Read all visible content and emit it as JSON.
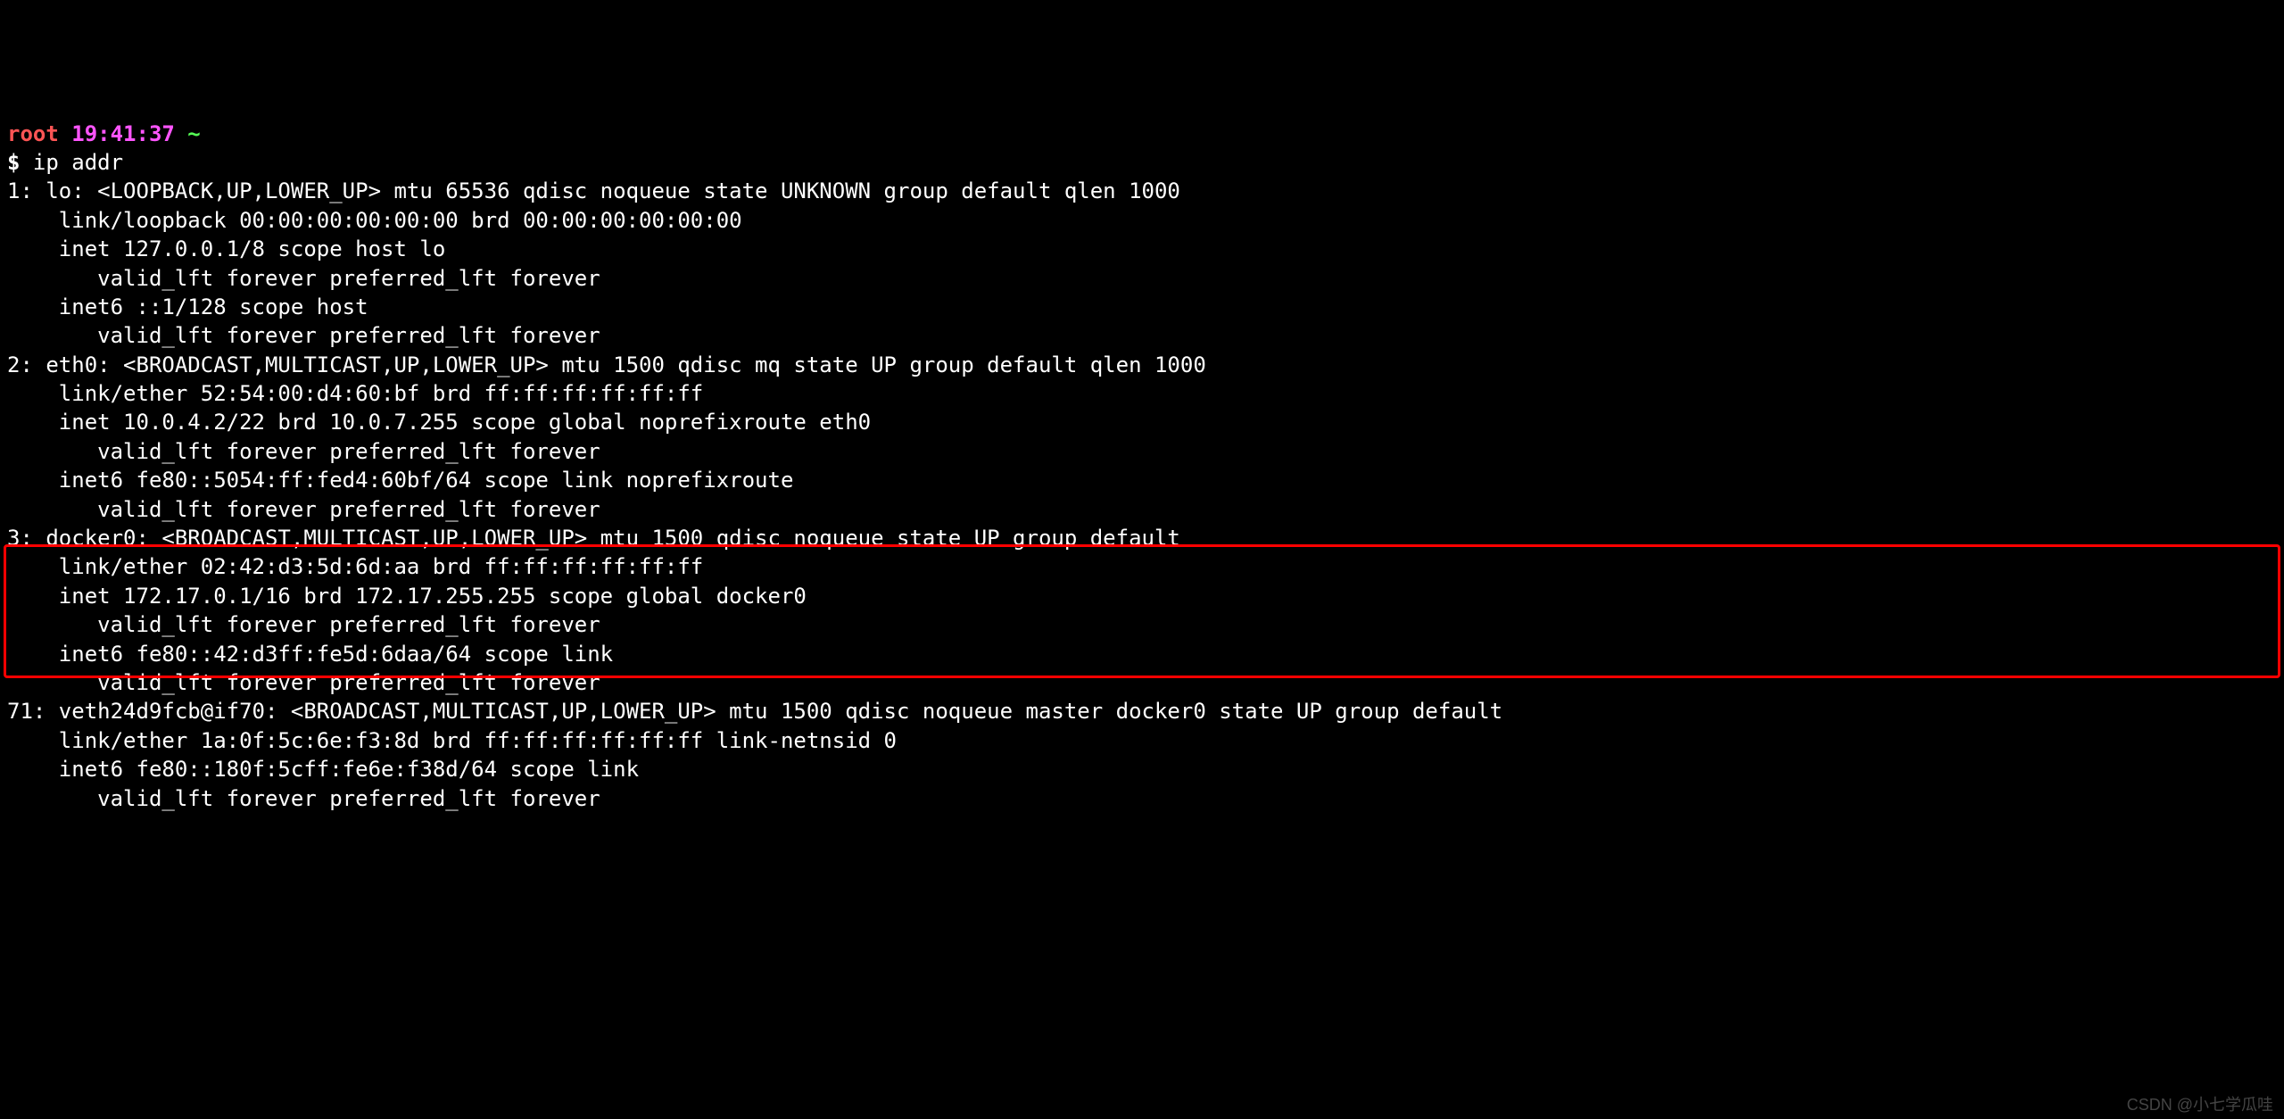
{
  "prompt": {
    "user": "root",
    "time": "19:41:37",
    "cwd": "~",
    "dollar": "$",
    "command": "ip addr"
  },
  "interfaces": [
    {
      "header": "1: lo: <LOOPBACK,UP,LOWER_UP> mtu 65536 qdisc noqueue state UNKNOWN group default qlen 1000",
      "lines": [
        "    link/loopback 00:00:00:00:00:00 brd 00:00:00:00:00:00",
        "    inet 127.0.0.1/8 scope host lo",
        "       valid_lft forever preferred_lft forever",
        "    inet6 ::1/128 scope host ",
        "       valid_lft forever preferred_lft forever"
      ]
    },
    {
      "header": "2: eth0: <BROADCAST,MULTICAST,UP,LOWER_UP> mtu 1500 qdisc mq state UP group default qlen 1000",
      "lines": [
        "    link/ether 52:54:00:d4:60:bf brd ff:ff:ff:ff:ff:ff",
        "    inet 10.0.4.2/22 brd 10.0.7.255 scope global noprefixroute eth0",
        "       valid_lft forever preferred_lft forever",
        "    inet6 fe80::5054:ff:fed4:60bf/64 scope link noprefixroute ",
        "       valid_lft forever preferred_lft forever"
      ]
    },
    {
      "header": "3: docker0: <BROADCAST,MULTICAST,UP,LOWER_UP> mtu 1500 qdisc noqueue state UP group default ",
      "lines": [
        "    link/ether 02:42:d3:5d:6d:aa brd ff:ff:ff:ff:ff:ff",
        "    inet 172.17.0.1/16 brd 172.17.255.255 scope global docker0",
        "       valid_lft forever preferred_lft forever",
        "    inet6 fe80::42:d3ff:fe5d:6daa/64 scope link ",
        "       valid_lft forever preferred_lft forever"
      ]
    },
    {
      "header": "71: veth24d9fcb@if70: <BROADCAST,MULTICAST,UP,LOWER_UP> mtu 1500 qdisc noqueue master docker0 state UP group default ",
      "lines": [
        "    link/ether 1a:0f:5c:6e:f3:8d brd ff:ff:ff:ff:ff:ff link-netnsid 0",
        "    inet6 fe80::180f:5cff:fe6e:f38d/64 scope link ",
        "       valid_lft forever preferred_lft forever"
      ],
      "highlighted": true
    }
  ],
  "watermark": "CSDN @小七学瓜哇"
}
